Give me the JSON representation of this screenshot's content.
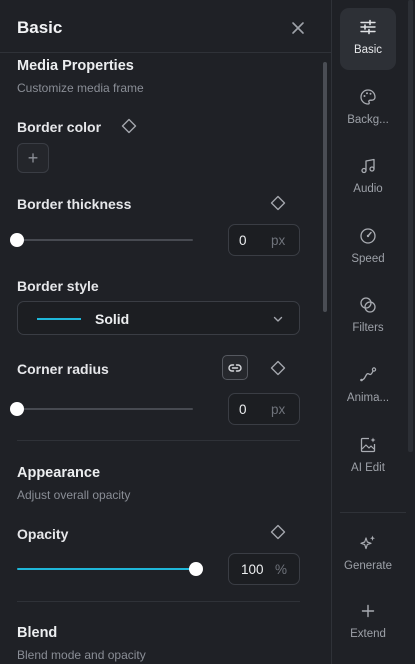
{
  "panel": {
    "title": "Basic",
    "media": {
      "title": "Media Properties",
      "subtitle": "Customize media frame"
    },
    "border_color": {
      "label": "Border color",
      "add_glyph": "+"
    },
    "border_thickness": {
      "label": "Border thickness",
      "value": "0",
      "unit": "px",
      "slider_fraction": 0
    },
    "border_style": {
      "label": "Border style",
      "value": "Solid"
    },
    "corner_radius": {
      "label": "Corner radius",
      "value": "0",
      "unit": "px",
      "slider_fraction": 0
    },
    "appearance": {
      "title": "Appearance",
      "subtitle": "Adjust overall opacity"
    },
    "opacity": {
      "label": "Opacity",
      "value": "100",
      "unit": "%",
      "slider_fraction": 1
    },
    "blend": {
      "title": "Blend",
      "subtitle": "Blend mode and opacity"
    }
  },
  "rail": {
    "items": [
      {
        "label": "Basic",
        "icon": "sliders-icon",
        "active": true
      },
      {
        "label": "Backg...",
        "icon": "palette-icon",
        "active": false
      },
      {
        "label": "Audio",
        "icon": "music-note-icon",
        "active": false
      },
      {
        "label": "Speed",
        "icon": "speedometer-icon",
        "active": false
      },
      {
        "label": "Filters",
        "icon": "filters-icon",
        "active": false
      },
      {
        "label": "Anima...",
        "icon": "animation-curve-icon",
        "active": false
      },
      {
        "label": "AI Edit",
        "icon": "ai-image-icon",
        "active": false
      },
      {
        "label": "Generate",
        "icon": "sparkles-icon",
        "active": false
      },
      {
        "label": "Extend",
        "icon": "plus-icon",
        "active": false
      }
    ]
  },
  "colors": {
    "accent": "#1fb7d9",
    "background": "#1f2126",
    "active_item": "#2d3036"
  }
}
